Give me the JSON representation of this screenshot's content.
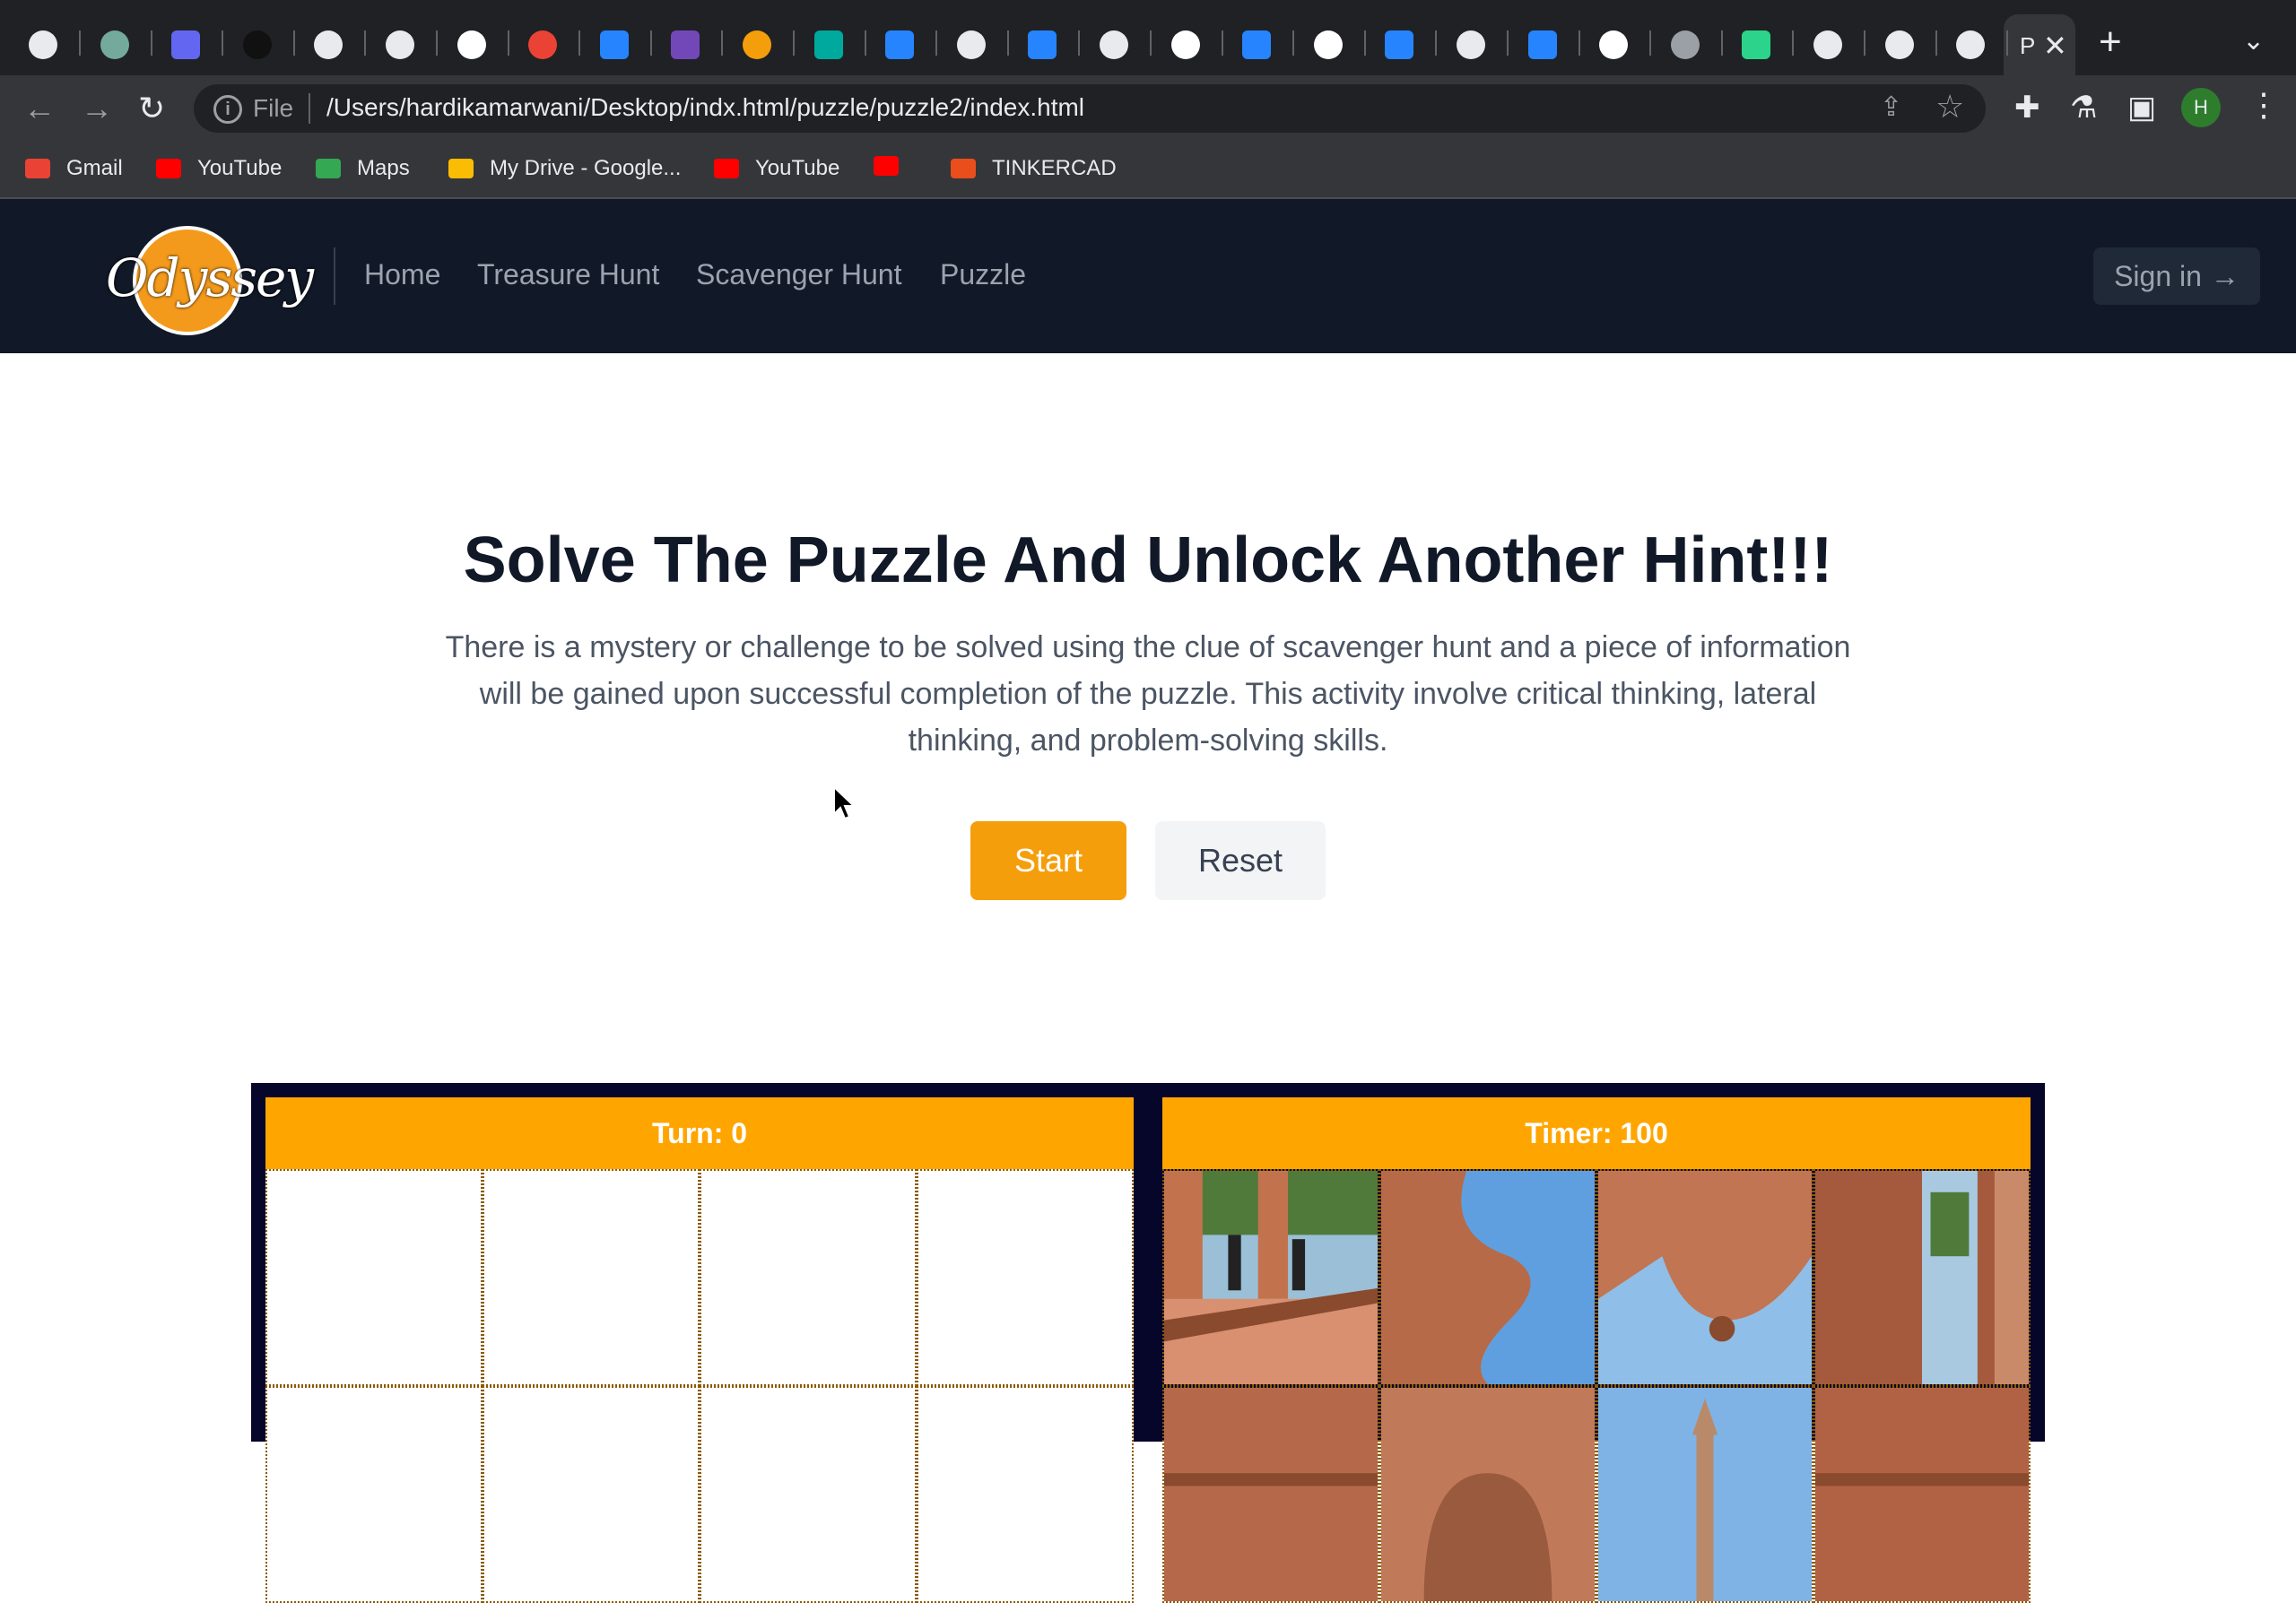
{
  "browser": {
    "tab_favicons": [
      {
        "icon": "globe-icon",
        "color": "#e8eaed"
      },
      {
        "icon": "chatgpt-icon",
        "color": "#74aa9c"
      },
      {
        "icon": "stack-icon",
        "color": "#6366f1"
      },
      {
        "icon": "unsplash-icon",
        "color": "#111111"
      },
      {
        "icon": "globe-icon",
        "color": "#e8eaed"
      },
      {
        "icon": "globe-icon",
        "color": "#e8eaed"
      },
      {
        "icon": "google-icon",
        "color": "#ffffff"
      },
      {
        "icon": "gmail-icon",
        "color": "#ea4335"
      },
      {
        "icon": "atlassian-icon",
        "color": "#2684ff"
      },
      {
        "icon": "forms-icon",
        "color": "#7248b9"
      },
      {
        "icon": "swirl-icon",
        "color": "#f59e0b"
      },
      {
        "icon": "diamond-icon",
        "color": "#00a99d"
      },
      {
        "icon": "bitbucket-icon",
        "color": "#2684ff"
      },
      {
        "icon": "globe-icon",
        "color": "#e8eaed"
      },
      {
        "icon": "atlassian-icon",
        "color": "#2684ff"
      },
      {
        "icon": "chrome-icon",
        "color": "#e8eaed"
      },
      {
        "icon": "google-icon",
        "color": "#ffffff"
      },
      {
        "icon": "atlassian-icon",
        "color": "#2684ff"
      },
      {
        "icon": "google-icon",
        "color": "#ffffff"
      },
      {
        "icon": "atlassian-icon",
        "color": "#2684ff"
      },
      {
        "icon": "chrome-icon",
        "color": "#e8eaed"
      },
      {
        "icon": "bitbucket-icon",
        "color": "#2684ff"
      },
      {
        "icon": "google-icon",
        "color": "#ffffff"
      },
      {
        "icon": "globe-icon",
        "color": "#9aa0a6"
      },
      {
        "icon": "sheet-icon",
        "color": "#2bd48a"
      },
      {
        "icon": "globe-icon",
        "color": "#e8eaed"
      },
      {
        "icon": "globe-icon",
        "color": "#e8eaed"
      },
      {
        "icon": "globe-icon",
        "color": "#e8eaed"
      }
    ],
    "active_tab_title": "P",
    "omnibox": {
      "scheme_label": "File",
      "url": "/Users/hardikamarwani/Desktop/indx.html/puzzle/puzzle2/index.html"
    },
    "profile_initial": "H",
    "bookmarks": [
      {
        "label": "Gmail",
        "icon": "gmail-icon",
        "color": "#ea4335"
      },
      {
        "label": "YouTube",
        "icon": "youtube-icon",
        "color": "#ff0000"
      },
      {
        "label": "Maps",
        "icon": "maps-icon",
        "color": "#34a853"
      },
      {
        "label": "My Drive - Google...",
        "icon": "drive-icon",
        "color": "#fbbc04"
      },
      {
        "label": "YouTube",
        "icon": "youtube-icon",
        "color": "#ff0000"
      },
      {
        "label": "",
        "icon": "youtube-icon",
        "color": "#ff0000"
      },
      {
        "label": "TINKERCAD",
        "icon": "tinkercad-icon",
        "color": "#e94e1b"
      }
    ]
  },
  "site": {
    "logo_text": "Odyssey",
    "nav": [
      "Home",
      "Treasure Hunt",
      "Scavenger Hunt",
      "Puzzle"
    ],
    "signin_label": "Sign in",
    "signin_arrow": "→"
  },
  "hero": {
    "title": "Solve The Puzzle And Unlock Another Hint!!!",
    "description": "There is a mystery or challenge to be solved using the clue of scavenger hunt and a piece of information will be gained upon successful completion of the puzzle. This activity involve critical thinking, lateral thinking, and problem-solving skills.",
    "start_label": "Start",
    "reset_label": "Reset"
  },
  "game": {
    "turn_label": "Turn: 0",
    "timer_label": "Timer: 100",
    "board_cells": 8,
    "pieces": [
      {
        "scene": "balcony-people",
        "sky": "#9bbfd6",
        "stone": "#c2734e"
      },
      {
        "scene": "stone-curve-sky",
        "sky": "#5f9fe0",
        "stone": "#b76a48"
      },
      {
        "scene": "stone-dome-sky",
        "sky": "#8fbfe8",
        "stone": "#c17552"
      },
      {
        "scene": "doorway-view",
        "sky": "#a8c9e0",
        "stone": "#a65a3d"
      },
      {
        "scene": "stone-wall",
        "sky": "#9bbfd6",
        "stone": "#b5694a"
      },
      {
        "scene": "carved-arch",
        "sky": "#9bbfd6",
        "stone": "#c07a5a"
      },
      {
        "scene": "spire-sky",
        "sky": "#7fb3e6",
        "stone": "#b98a6a"
      },
      {
        "scene": "stone-wall",
        "sky": "#9bbfd6",
        "stone": "#b26244"
      }
    ]
  }
}
